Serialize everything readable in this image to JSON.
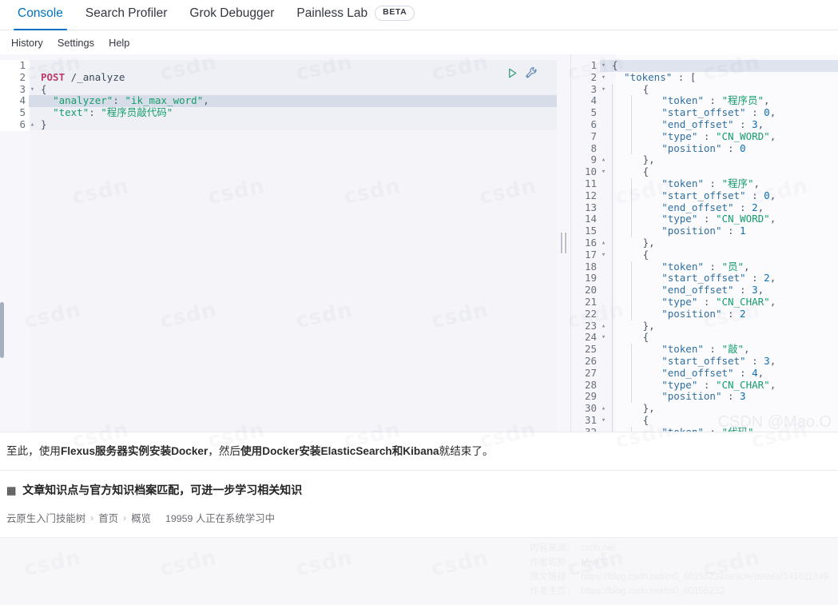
{
  "tabs": [
    {
      "label": "Console",
      "active": true,
      "badge": null
    },
    {
      "label": "Search Profiler",
      "active": false,
      "badge": null
    },
    {
      "label": "Grok Debugger",
      "active": false,
      "badge": null
    },
    {
      "label": "Painless Lab",
      "active": false,
      "badge": "BETA"
    }
  ],
  "submenu": [
    {
      "label": "History"
    },
    {
      "label": "Settings"
    },
    {
      "label": "Help"
    }
  ],
  "editor": {
    "active_line": 4,
    "run_icon": "play-icon",
    "wrench_icon": "wrench-icon",
    "lines": [
      {
        "n": 1,
        "fold": "",
        "tokens": []
      },
      {
        "n": 2,
        "fold": "",
        "tokens": [
          {
            "t": "POST",
            "c": "t-method"
          },
          {
            "t": " ",
            "c": "t-punc"
          },
          {
            "t": "/_analyze",
            "c": "t-url"
          }
        ]
      },
      {
        "n": 3,
        "fold": "▾",
        "tokens": [
          {
            "t": "{",
            "c": "t-punc"
          }
        ]
      },
      {
        "n": 4,
        "fold": "",
        "tokens": [
          {
            "t": "  ",
            "c": "t-punc"
          },
          {
            "t": "\"analyzer\"",
            "c": "t-str"
          },
          {
            "t": ": ",
            "c": "t-punc"
          },
          {
            "t": "\"ik_max_word\"",
            "c": "t-str"
          },
          {
            "t": ",",
            "c": "t-punc"
          }
        ]
      },
      {
        "n": 5,
        "fold": "",
        "tokens": [
          {
            "t": "  ",
            "c": "t-punc"
          },
          {
            "t": "\"text\"",
            "c": "t-str"
          },
          {
            "t": ": ",
            "c": "t-punc"
          },
          {
            "t": "\"程序员敲代码\"",
            "c": "t-str"
          }
        ]
      },
      {
        "n": 6,
        "fold": "▴",
        "tokens": [
          {
            "t": "}",
            "c": "t-punc"
          }
        ]
      }
    ]
  },
  "output": {
    "active_line": 1,
    "lines": [
      {
        "n": 1,
        "fold": "▾",
        "indent": 0,
        "tokens": [
          {
            "t": "{",
            "c": "t-punc"
          }
        ]
      },
      {
        "n": 2,
        "fold": "▾",
        "indent": 0,
        "tokens": [
          {
            "t": "  \"tokens\"",
            "c": "t-key"
          },
          {
            "t": " : [",
            "c": "t-punc"
          }
        ]
      },
      {
        "n": 3,
        "fold": "▾",
        "indent": 1,
        "tokens": [
          {
            "t": "  {",
            "c": "t-punc"
          }
        ]
      },
      {
        "n": 4,
        "fold": "",
        "indent": 2,
        "tokens": [
          {
            "t": "  \"token\"",
            "c": "t-key"
          },
          {
            "t": " : ",
            "c": "t-punc"
          },
          {
            "t": "\"程序员\"",
            "c": "t-str"
          },
          {
            "t": ",",
            "c": "t-punc"
          }
        ]
      },
      {
        "n": 5,
        "fold": "",
        "indent": 2,
        "tokens": [
          {
            "t": "  \"start_offset\"",
            "c": "t-key"
          },
          {
            "t": " : ",
            "c": "t-punc"
          },
          {
            "t": "0",
            "c": "t-num"
          },
          {
            "t": ",",
            "c": "t-punc"
          }
        ]
      },
      {
        "n": 6,
        "fold": "",
        "indent": 2,
        "tokens": [
          {
            "t": "  \"end_offset\"",
            "c": "t-key"
          },
          {
            "t": " : ",
            "c": "t-punc"
          },
          {
            "t": "3",
            "c": "t-num"
          },
          {
            "t": ",",
            "c": "t-punc"
          }
        ]
      },
      {
        "n": 7,
        "fold": "",
        "indent": 2,
        "tokens": [
          {
            "t": "  \"type\"",
            "c": "t-key"
          },
          {
            "t": " : ",
            "c": "t-punc"
          },
          {
            "t": "\"CN_WORD\"",
            "c": "t-str"
          },
          {
            "t": ",",
            "c": "t-punc"
          }
        ]
      },
      {
        "n": 8,
        "fold": "",
        "indent": 2,
        "tokens": [
          {
            "t": "  \"position\"",
            "c": "t-key"
          },
          {
            "t": " : ",
            "c": "t-punc"
          },
          {
            "t": "0",
            "c": "t-num"
          }
        ]
      },
      {
        "n": 9,
        "fold": "▴",
        "indent": 1,
        "tokens": [
          {
            "t": "  },",
            "c": "t-punc"
          }
        ]
      },
      {
        "n": 10,
        "fold": "▾",
        "indent": 1,
        "tokens": [
          {
            "t": "  {",
            "c": "t-punc"
          }
        ]
      },
      {
        "n": 11,
        "fold": "",
        "indent": 2,
        "tokens": [
          {
            "t": "  \"token\"",
            "c": "t-key"
          },
          {
            "t": " : ",
            "c": "t-punc"
          },
          {
            "t": "\"程序\"",
            "c": "t-str"
          },
          {
            "t": ",",
            "c": "t-punc"
          }
        ]
      },
      {
        "n": 12,
        "fold": "",
        "indent": 2,
        "tokens": [
          {
            "t": "  \"start_offset\"",
            "c": "t-key"
          },
          {
            "t": " : ",
            "c": "t-punc"
          },
          {
            "t": "0",
            "c": "t-num"
          },
          {
            "t": ",",
            "c": "t-punc"
          }
        ]
      },
      {
        "n": 13,
        "fold": "",
        "indent": 2,
        "tokens": [
          {
            "t": "  \"end_offset\"",
            "c": "t-key"
          },
          {
            "t": " : ",
            "c": "t-punc"
          },
          {
            "t": "2",
            "c": "t-num"
          },
          {
            "t": ",",
            "c": "t-punc"
          }
        ]
      },
      {
        "n": 14,
        "fold": "",
        "indent": 2,
        "tokens": [
          {
            "t": "  \"type\"",
            "c": "t-key"
          },
          {
            "t": " : ",
            "c": "t-punc"
          },
          {
            "t": "\"CN_WORD\"",
            "c": "t-str"
          },
          {
            "t": ",",
            "c": "t-punc"
          }
        ]
      },
      {
        "n": 15,
        "fold": "",
        "indent": 2,
        "tokens": [
          {
            "t": "  \"position\"",
            "c": "t-key"
          },
          {
            "t": " : ",
            "c": "t-punc"
          },
          {
            "t": "1",
            "c": "t-num"
          }
        ]
      },
      {
        "n": 16,
        "fold": "▴",
        "indent": 1,
        "tokens": [
          {
            "t": "  },",
            "c": "t-punc"
          }
        ]
      },
      {
        "n": 17,
        "fold": "▾",
        "indent": 1,
        "tokens": [
          {
            "t": "  {",
            "c": "t-punc"
          }
        ]
      },
      {
        "n": 18,
        "fold": "",
        "indent": 2,
        "tokens": [
          {
            "t": "  \"token\"",
            "c": "t-key"
          },
          {
            "t": " : ",
            "c": "t-punc"
          },
          {
            "t": "\"员\"",
            "c": "t-str"
          },
          {
            "t": ",",
            "c": "t-punc"
          }
        ]
      },
      {
        "n": 19,
        "fold": "",
        "indent": 2,
        "tokens": [
          {
            "t": "  \"start_offset\"",
            "c": "t-key"
          },
          {
            "t": " : ",
            "c": "t-punc"
          },
          {
            "t": "2",
            "c": "t-num"
          },
          {
            "t": ",",
            "c": "t-punc"
          }
        ]
      },
      {
        "n": 20,
        "fold": "",
        "indent": 2,
        "tokens": [
          {
            "t": "  \"end_offset\"",
            "c": "t-key"
          },
          {
            "t": " : ",
            "c": "t-punc"
          },
          {
            "t": "3",
            "c": "t-num"
          },
          {
            "t": ",",
            "c": "t-punc"
          }
        ]
      },
      {
        "n": 21,
        "fold": "",
        "indent": 2,
        "tokens": [
          {
            "t": "  \"type\"",
            "c": "t-key"
          },
          {
            "t": " : ",
            "c": "t-punc"
          },
          {
            "t": "\"CN_CHAR\"",
            "c": "t-str"
          },
          {
            "t": ",",
            "c": "t-punc"
          }
        ]
      },
      {
        "n": 22,
        "fold": "",
        "indent": 2,
        "tokens": [
          {
            "t": "  \"position\"",
            "c": "t-key"
          },
          {
            "t": " : ",
            "c": "t-punc"
          },
          {
            "t": "2",
            "c": "t-num"
          }
        ]
      },
      {
        "n": 23,
        "fold": "▴",
        "indent": 1,
        "tokens": [
          {
            "t": "  },",
            "c": "t-punc"
          }
        ]
      },
      {
        "n": 24,
        "fold": "▾",
        "indent": 1,
        "tokens": [
          {
            "t": "  {",
            "c": "t-punc"
          }
        ]
      },
      {
        "n": 25,
        "fold": "",
        "indent": 2,
        "tokens": [
          {
            "t": "  \"token\"",
            "c": "t-key"
          },
          {
            "t": " : ",
            "c": "t-punc"
          },
          {
            "t": "\"敲\"",
            "c": "t-str"
          },
          {
            "t": ",",
            "c": "t-punc"
          }
        ]
      },
      {
        "n": 26,
        "fold": "",
        "indent": 2,
        "tokens": [
          {
            "t": "  \"start_offset\"",
            "c": "t-key"
          },
          {
            "t": " : ",
            "c": "t-punc"
          },
          {
            "t": "3",
            "c": "t-num"
          },
          {
            "t": ",",
            "c": "t-punc"
          }
        ]
      },
      {
        "n": 27,
        "fold": "",
        "indent": 2,
        "tokens": [
          {
            "t": "  \"end_offset\"",
            "c": "t-key"
          },
          {
            "t": " : ",
            "c": "t-punc"
          },
          {
            "t": "4",
            "c": "t-num"
          },
          {
            "t": ",",
            "c": "t-punc"
          }
        ]
      },
      {
        "n": 28,
        "fold": "",
        "indent": 2,
        "tokens": [
          {
            "t": "  \"type\"",
            "c": "t-key"
          },
          {
            "t": " : ",
            "c": "t-punc"
          },
          {
            "t": "\"CN_CHAR\"",
            "c": "t-str"
          },
          {
            "t": ",",
            "c": "t-punc"
          }
        ]
      },
      {
        "n": 29,
        "fold": "",
        "indent": 2,
        "tokens": [
          {
            "t": "  \"position\"",
            "c": "t-key"
          },
          {
            "t": " : ",
            "c": "t-punc"
          },
          {
            "t": "3",
            "c": "t-num"
          }
        ]
      },
      {
        "n": 30,
        "fold": "▴",
        "indent": 1,
        "tokens": [
          {
            "t": "  },",
            "c": "t-punc"
          }
        ]
      },
      {
        "n": 31,
        "fold": "▾",
        "indent": 1,
        "tokens": [
          {
            "t": "  {",
            "c": "t-punc"
          }
        ]
      },
      {
        "n": 32,
        "fold": "",
        "indent": 2,
        "tokens": [
          {
            "t": "  \"token\"",
            "c": "t-key"
          },
          {
            "t": " : ",
            "c": "t-punc"
          },
          {
            "t": "\"代码\"",
            "c": "t-str"
          },
          {
            "t": ",",
            "c": "t-punc"
          }
        ]
      }
    ]
  },
  "article": {
    "paragraph_parts": [
      {
        "t": "至此，使用",
        "b": false
      },
      {
        "t": "Flexus服务器实例安装Docker",
        "b": true
      },
      {
        "t": "，然后",
        "b": false
      },
      {
        "t": "使用Docker安装ElasticSearch和Kibana",
        "b": true
      },
      {
        "t": "就结束了。",
        "b": false
      }
    ],
    "knowledge": {
      "icon": "book-icon",
      "title": "文章知识点与官方知识档案匹配，可进一步学习相关知识",
      "breadcrumb": [
        "云原生入门技能树",
        "首页",
        "概览"
      ],
      "separator": "›",
      "learners": "19959 人正在系统学习中"
    }
  },
  "watermarks": {
    "tile_text": "csdn",
    "signature": "CSDN @Mao.O"
  },
  "footer_meta": [
    {
      "label": "内容来源：",
      "value": "csdn.net"
    },
    {
      "label": "作者昵称：",
      "value": "Mao.O"
    },
    {
      "label": "原文链接：",
      "value": "https://blog.csdn.net/m0_60155232/article/details/141611049"
    },
    {
      "label": "作者主页：",
      "value": "https://blog.csdn.net/m0_60155232"
    }
  ]
}
